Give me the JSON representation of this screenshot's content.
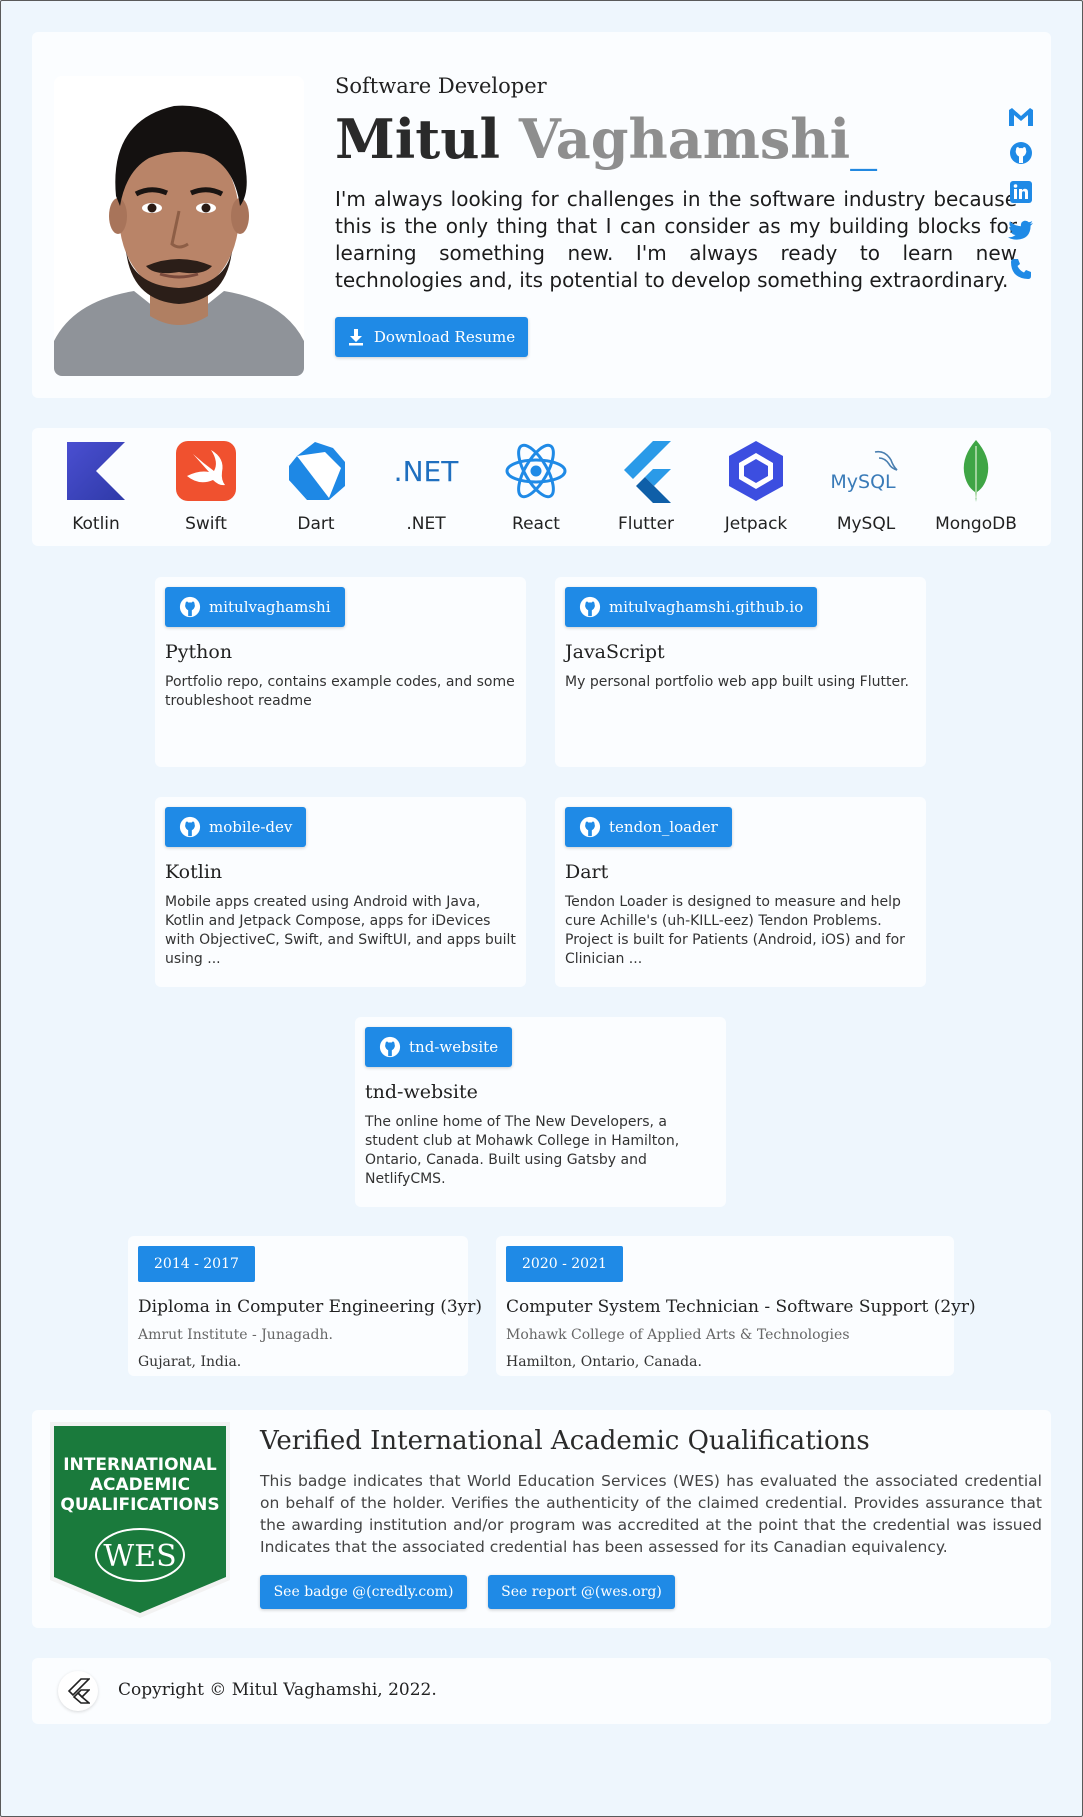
{
  "hero": {
    "role": "Software Developer",
    "first_name": "Mitul",
    "last_name": "Vaghamshi",
    "cursor": "_",
    "bio": "I'm always looking for challenges in the software industry because this is the only thing that I can consider as my building blocks for learning something new. I'm always ready to learn new technologies and, its potential to develop something extraordinary.",
    "download_label": "Download Resume",
    "social_icons": [
      "gmail-icon",
      "github-icon",
      "linkedin-icon",
      "twitter-icon",
      "phone-icon"
    ],
    "accent": "#1f8ae6"
  },
  "skills": [
    {
      "label": "Kotlin",
      "icon": "kotlin-icon"
    },
    {
      "label": "Swift",
      "icon": "swift-icon"
    },
    {
      "label": "Dart",
      "icon": "dart-icon"
    },
    {
      "label": ".NET",
      "icon": "dotnet-icon"
    },
    {
      "label": "React",
      "icon": "react-icon"
    },
    {
      "label": "Flutter",
      "icon": "flutter-icon"
    },
    {
      "label": "Jetpack",
      "icon": "jetpack-icon"
    },
    {
      "label": "MySQL",
      "icon": "mysql-icon"
    },
    {
      "label": "MongoDB",
      "icon": "mongodb-icon"
    }
  ],
  "dotnet_logo_text": ".NET",
  "mysql_logo_text": "MySQL",
  "repos": [
    {
      "name": "mitulvaghamshi",
      "lang": "Python",
      "desc": "Portfolio repo, contains example codes, and some troubleshoot readme"
    },
    {
      "name": "mitulvaghamshi.github.io",
      "lang": "JavaScript",
      "desc": "My personal portfolio web app built using Flutter."
    },
    {
      "name": "mobile-dev",
      "lang": "Kotlin",
      "desc": "Mobile apps created using Android with Java, Kotlin and Jetpack Compose, apps for iDevices with ObjectiveC, Swift, and SwiftUI, and apps built using ..."
    },
    {
      "name": "tendon_loader",
      "lang": "Dart",
      "desc": "Tendon Loader is designed to measure and help cure Achille's (uh-KILL-eez) Tendon Problems. Project is built for Patients (Android, iOS) and for Clinician ..."
    },
    {
      "name": "tnd-website",
      "lang": "tnd-website",
      "desc": "The online home of The New Developers, a student club at Mohawk College in Hamilton, Ontario, Canada. Built using Gatsby and NetlifyCMS."
    }
  ],
  "education": [
    {
      "years": "2014 - 2017",
      "degree": "Diploma in Computer Engineering (3yr)",
      "institute": "Amrut Institute - Junagadh.",
      "location": "Gujarat, India."
    },
    {
      "years": "2020 - 2021",
      "degree": "Computer System Technician - Software Support (2yr)",
      "institute": "Mohawk College of Applied Arts & Technologies",
      "location": "Hamilton, Ontario, Canada."
    }
  ],
  "wes": {
    "badge_lines": [
      "INTERNATIONAL",
      "ACADEMIC",
      "QUALIFICATIONS"
    ],
    "badge_logo": "WES",
    "title": "Verified International Academic Qualifications",
    "desc": "This badge indicates that World Education Services (WES) has evaluated the associated credential on behalf of the holder. Verifies the authenticity of the claimed credential. Provides assurance that the awarding institution and/or program was accredited at the point that the credential was issued Indicates that the associated credential has been assessed for its Canadian equivalency.",
    "badge_button": "See badge @(credly.com)",
    "report_button": "See report @(wes.org)",
    "badge_color": "#1a7a3c"
  },
  "footer": {
    "copyright": "Copyright © Mitul Vaghamshi, 2022."
  }
}
